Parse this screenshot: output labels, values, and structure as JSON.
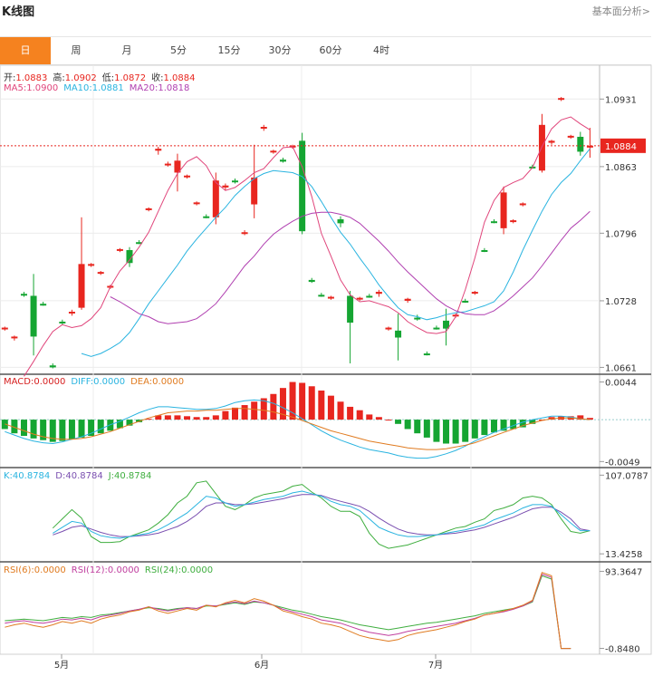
{
  "header": {
    "title": "K线图",
    "link": "基本面分析>"
  },
  "tabs": [
    "日",
    "周",
    "月",
    "5分",
    "15分",
    "30分",
    "60分",
    "4时"
  ],
  "active_tab": 0,
  "legends": {
    "ohlc": [
      {
        "label": "开:",
        "value": "1.0883"
      },
      {
        "label": "高:",
        "value": "1.0902"
      },
      {
        "label": "低:",
        "value": "1.0872"
      },
      {
        "label": "收:",
        "value": "1.0884"
      }
    ],
    "ma": [
      {
        "label": "MA5:",
        "value": "1.0900"
      },
      {
        "label": "MA10:",
        "value": "1.0881"
      },
      {
        "label": "MA20:",
        "value": "1.0818"
      }
    ],
    "macd": [
      {
        "label": "MACD:",
        "value": "0.0000"
      },
      {
        "label": "DIFF:",
        "value": "0.0000"
      },
      {
        "label": "DEA:",
        "value": "0.0000"
      }
    ],
    "kdj": [
      {
        "label": "K:",
        "value": "40.8784"
      },
      {
        "label": "D:",
        "value": "40.8784"
      },
      {
        "label": "J:",
        "value": "40.8784"
      }
    ],
    "rsi": [
      {
        "label": "RSI(6):",
        "value": "0.0000"
      },
      {
        "label": "RSI(12):",
        "value": "0.0000"
      },
      {
        "label": "RSI(24):",
        "value": "0.0000"
      }
    ]
  },
  "colors": {
    "up": "#e8261f",
    "down": "#15a532",
    "ma5": "#e0457b",
    "ma10": "#2ab4e0",
    "ma20": "#b03fb0",
    "diff": "#2ab4e0",
    "dea": "#e07b20",
    "k": "#2ab4e0",
    "d": "#7a4fb0",
    "j": "#3fae3f",
    "rsi6": "#e07b20",
    "rsi12": "#c03f9f",
    "rsi24": "#3fae3f"
  },
  "chart_data": {
    "type": "candlestick",
    "x_labels": [
      {
        "index": 5,
        "label": "5月"
      },
      {
        "index": 25,
        "label": "6月"
      },
      {
        "index": 43,
        "label": "7月"
      }
    ],
    "last_price_label": "1.0884",
    "price_ylim": [
      1.0655,
      1.0965
    ],
    "price_ticks": [
      "1.0931",
      "1.0863",
      "1.0796",
      "1.0728",
      "1.0661"
    ],
    "candles": [
      {
        "o": 1.07,
        "h": 1.0702,
        "l": 1.0698,
        "c": 1.0701
      },
      {
        "o": 1.0691,
        "h": 1.0693,
        "l": 1.0688,
        "c": 1.0692
      },
      {
        "o": 1.0735,
        "h": 1.0737,
        "l": 1.0732,
        "c": 1.0734
      },
      {
        "o": 1.0733,
        "h": 1.0755,
        "l": 1.0673,
        "c": 1.0692
      },
      {
        "o": 1.0725,
        "h": 1.0727,
        "l": 1.0723,
        "c": 1.0724
      },
      {
        "o": 1.0663,
        "h": 1.0665,
        "l": 1.066,
        "c": 1.0661
      },
      {
        "o": 1.0707,
        "h": 1.0709,
        "l": 1.0704,
        "c": 1.0706
      },
      {
        "o": 1.0716,
        "h": 1.0719,
        "l": 1.0713,
        "c": 1.0717
      },
      {
        "o": 1.0721,
        "h": 1.0812,
        "l": 1.0719,
        "c": 1.0765
      },
      {
        "o": 1.0764,
        "h": 1.0766,
        "l": 1.0762,
        "c": 1.0765
      },
      {
        "o": 1.0756,
        "h": 1.0758,
        "l": 1.0754,
        "c": 1.0757
      },
      {
        "o": 1.0742,
        "h": 1.0744,
        "l": 1.074,
        "c": 1.0743
      },
      {
        "o": 1.0779,
        "h": 1.0781,
        "l": 1.0777,
        "c": 1.078
      },
      {
        "o": 1.0779,
        "h": 1.0782,
        "l": 1.0762,
        "c": 1.0766
      },
      {
        "o": 1.0787,
        "h": 1.0789,
        "l": 1.0785,
        "c": 1.0786
      },
      {
        "o": 1.082,
        "h": 1.0822,
        "l": 1.0818,
        "c": 1.0821
      },
      {
        "o": 1.0879,
        "h": 1.0883,
        "l": 1.0875,
        "c": 1.0881
      },
      {
        "o": 1.0865,
        "h": 1.0868,
        "l": 1.0863,
        "c": 1.0866
      },
      {
        "o": 1.0857,
        "h": 1.0876,
        "l": 1.0838,
        "c": 1.0869
      },
      {
        "o": 1.0853,
        "h": 1.0855,
        "l": 1.0851,
        "c": 1.0854
      },
      {
        "o": 1.0826,
        "h": 1.0828,
        "l": 1.0824,
        "c": 1.0827
      },
      {
        "o": 1.0813,
        "h": 1.0815,
        "l": 1.0811,
        "c": 1.0812
      },
      {
        "o": 1.0812,
        "h": 1.0857,
        "l": 1.0805,
        "c": 1.0849
      },
      {
        "o": 1.0842,
        "h": 1.0846,
        "l": 1.0839,
        "c": 1.0844
      },
      {
        "o": 1.0849,
        "h": 1.0851,
        "l": 1.0846,
        "c": 1.0848
      },
      {
        "o": 1.0796,
        "h": 1.0799,
        "l": 1.0794,
        "c": 1.0797
      },
      {
        "o": 1.0825,
        "h": 1.0885,
        "l": 1.0811,
        "c": 1.0852
      },
      {
        "o": 1.0902,
        "h": 1.0905,
        "l": 1.0899,
        "c": 1.0903
      },
      {
        "o": 1.0878,
        "h": 1.088,
        "l": 1.0876,
        "c": 1.0879
      },
      {
        "o": 1.087,
        "h": 1.0872,
        "l": 1.0867,
        "c": 1.0868
      },
      {
        "o": 1.0883,
        "h": 1.0885,
        "l": 1.0881,
        "c": 1.0884
      },
      {
        "o": 1.0889,
        "h": 1.0897,
        "l": 1.0795,
        "c": 1.0798
      },
      {
        "o": 1.0749,
        "h": 1.0751,
        "l": 1.0746,
        "c": 1.0747
      },
      {
        "o": 1.0734,
        "h": 1.0736,
        "l": 1.0732,
        "c": 1.0733
      },
      {
        "o": 1.0731,
        "h": 1.0733,
        "l": 1.0729,
        "c": 1.0732
      },
      {
        "o": 1.081,
        "h": 1.0813,
        "l": 1.0802,
        "c": 1.0806
      },
      {
        "o": 1.0733,
        "h": 1.0738,
        "l": 1.0665,
        "c": 1.0706
      },
      {
        "o": 1.073,
        "h": 1.0732,
        "l": 1.0728,
        "c": 1.0731
      },
      {
        "o": 1.0733,
        "h": 1.0735,
        "l": 1.0731,
        "c": 1.0732
      },
      {
        "o": 1.0735,
        "h": 1.0739,
        "l": 1.0732,
        "c": 1.0737
      },
      {
        "o": 1.07,
        "h": 1.0702,
        "l": 1.0698,
        "c": 1.0701
      },
      {
        "o": 1.0698,
        "h": 1.0715,
        "l": 1.0668,
        "c": 1.0691
      },
      {
        "o": 1.0728,
        "h": 1.0731,
        "l": 1.0726,
        "c": 1.073
      },
      {
        "o": 1.0711,
        "h": 1.0714,
        "l": 1.0708,
        "c": 1.071
      },
      {
        "o": 1.0675,
        "h": 1.0677,
        "l": 1.0673,
        "c": 1.0674
      },
      {
        "o": 1.0701,
        "h": 1.0703,
        "l": 1.0699,
        "c": 1.07
      },
      {
        "o": 1.0708,
        "h": 1.072,
        "l": 1.0683,
        "c": 1.07
      },
      {
        "o": 1.0713,
        "h": 1.0715,
        "l": 1.0711,
        "c": 1.0714
      },
      {
        "o": 1.0728,
        "h": 1.073,
        "l": 1.0726,
        "c": 1.0727
      },
      {
        "o": 1.0736,
        "h": 1.0738,
        "l": 1.0734,
        "c": 1.0737
      },
      {
        "o": 1.0779,
        "h": 1.0781,
        "l": 1.0777,
        "c": 1.0778
      },
      {
        "o": 1.0808,
        "h": 1.081,
        "l": 1.0806,
        "c": 1.0807
      },
      {
        "o": 1.0801,
        "h": 1.0843,
        "l": 1.0795,
        "c": 1.0837
      },
      {
        "o": 1.0808,
        "h": 1.081,
        "l": 1.0806,
        "c": 1.0809
      },
      {
        "o": 1.0825,
        "h": 1.0827,
        "l": 1.0823,
        "c": 1.0826
      },
      {
        "o": 1.0863,
        "h": 1.0865,
        "l": 1.0861,
        "c": 1.0862
      },
      {
        "o": 1.0859,
        "h": 1.0916,
        "l": 1.0857,
        "c": 1.0905
      },
      {
        "o": 1.0887,
        "h": 1.089,
        "l": 1.0885,
        "c": 1.0889
      },
      {
        "o": 1.0931,
        "h": 1.0933,
        "l": 1.0929,
        "c": 1.0932
      },
      {
        "o": 1.0893,
        "h": 1.0895,
        "l": 1.0891,
        "c": 1.0894
      },
      {
        "o": 1.0893,
        "h": 1.0898,
        "l": 1.0874,
        "c": 1.0878
      },
      {
        "o": 1.0883,
        "h": 1.0902,
        "l": 1.0872,
        "c": 1.0884
      }
    ],
    "ma5": [
      1.0652,
      1.0667,
      1.0683,
      1.0697,
      1.0704,
      1.0701,
      1.0703,
      1.071,
      1.0721,
      1.0742,
      1.0758,
      1.0769,
      1.0782,
      1.0797,
      1.0818,
      1.0839,
      1.0856,
      1.0868,
      1.0873,
      1.0864,
      1.0847,
      1.0839,
      1.0842,
      1.0849,
      1.0857,
      1.0861,
      1.0872,
      1.0882,
      1.0883,
      1.0863,
      1.0833,
      1.0796,
      1.0773,
      1.0749,
      1.0734,
      1.0727,
      1.0728,
      1.0725,
      1.0722,
      1.0716,
      1.0707,
      1.0701,
      1.0696,
      1.0695,
      1.0697,
      1.0712,
      1.0739,
      1.0771,
      1.0807,
      1.0829,
      1.0842,
      1.0847,
      1.0851,
      1.0862,
      1.0883,
      1.0901,
      1.091,
      1.0913,
      1.0906,
      1.09
    ],
    "ma10": [
      1.0675,
      1.0672,
      1.0675,
      1.068,
      1.0686,
      1.0696,
      1.071,
      1.0725,
      1.0738,
      1.0751,
      1.0764,
      1.0778,
      1.079,
      1.0801,
      1.0812,
      1.0822,
      1.0834,
      1.0843,
      1.0851,
      1.0856,
      1.0859,
      1.0858,
      1.0857,
      1.0853,
      1.0843,
      1.0828,
      1.0812,
      1.0797,
      1.0785,
      1.0771,
      1.0758,
      1.0744,
      1.0732,
      1.0721,
      1.0714,
      1.0712,
      1.0709,
      1.0711,
      1.0714,
      1.0716,
      1.0717,
      1.072,
      1.0723,
      1.0727,
      1.0738,
      1.0757,
      1.0779,
      1.0799,
      1.0818,
      1.0835,
      1.0847,
      1.0856,
      1.0869,
      1.0881
    ],
    "ma20": [
      1.0732,
      1.0727,
      1.0721,
      1.0715,
      1.0712,
      1.0707,
      1.0705,
      1.0706,
      1.0707,
      1.071,
      1.0717,
      1.0725,
      1.0737,
      1.075,
      1.0763,
      1.0773,
      1.0785,
      1.0795,
      1.0802,
      1.0808,
      1.0813,
      1.0816,
      1.0817,
      1.0817,
      1.0815,
      1.0812,
      1.0806,
      1.0797,
      1.0788,
      1.0778,
      1.0767,
      1.0757,
      1.0748,
      1.0739,
      1.073,
      1.0723,
      1.0718,
      1.0715,
      1.0714,
      1.0714,
      1.0718,
      1.0725,
      1.0733,
      1.0742,
      1.0751,
      1.0763,
      1.0776,
      1.0789,
      1.0801,
      1.0809,
      1.0818
    ],
    "macd": {
      "ylim": [
        -0.0055,
        0.0052
      ],
      "ticks": [
        "0.0044",
        "-0.0049"
      ],
      "bars": [
        -0.0011,
        -0.0016,
        -0.0019,
        -0.0022,
        -0.0024,
        -0.0026,
        -0.0025,
        -0.0023,
        -0.0021,
        -0.0019,
        -0.0016,
        -0.0013,
        -0.001,
        -0.0007,
        -0.0003,
        0.0001,
        0.0005,
        0.0005,
        0.0005,
        0.0004,
        0.0003,
        0.0003,
        0.0005,
        0.001,
        0.0014,
        0.0017,
        0.0021,
        0.0025,
        0.003,
        0.0037,
        0.0044,
        0.0043,
        0.0039,
        0.0034,
        0.0028,
        0.0021,
        0.0015,
        0.0011,
        0.0006,
        0.0003,
        0.0,
        -0.0005,
        -0.0011,
        -0.0016,
        -0.0021,
        -0.0026,
        -0.0028,
        -0.0028,
        -0.0026,
        -0.0022,
        -0.0018,
        -0.0015,
        -0.0013,
        -0.0011,
        -0.0009,
        -0.0005,
        0.0,
        0.0003,
        0.0004,
        0.0004,
        0.0005,
        0.0002
      ],
      "diff": [
        -0.0014,
        -0.0018,
        -0.0022,
        -0.0025,
        -0.0027,
        -0.0028,
        -0.0026,
        -0.0023,
        -0.002,
        -0.0016,
        -0.0011,
        -0.0006,
        -0.0002,
        0.0003,
        0.0008,
        0.0012,
        0.0015,
        0.0015,
        0.0014,
        0.0013,
        0.0012,
        0.0012,
        0.0013,
        0.0016,
        0.002,
        0.0022,
        0.0023,
        0.0022,
        0.0019,
        0.0014,
        0.0008,
        0.0001,
        -0.0006,
        -0.0013,
        -0.0019,
        -0.0024,
        -0.0028,
        -0.0032,
        -0.0035,
        -0.0037,
        -0.0039,
        -0.0042,
        -0.0044,
        -0.0045,
        -0.0045,
        -0.0043,
        -0.004,
        -0.0036,
        -0.0031,
        -0.0025,
        -0.002,
        -0.0015,
        -0.0011,
        -0.0007,
        -0.0003,
        0.0,
        0.0002,
        0.0004,
        0.0004,
        0.0003,
        0.0001,
        0.0
      ],
      "dea": [
        -0.0005,
        -0.0009,
        -0.0013,
        -0.0017,
        -0.002,
        -0.0022,
        -0.0023,
        -0.0023,
        -0.0022,
        -0.002,
        -0.0017,
        -0.0014,
        -0.001,
        -0.0006,
        -0.0002,
        0.0002,
        0.0005,
        0.0008,
        0.0009,
        0.001,
        0.001,
        0.0011,
        0.0011,
        0.0012,
        0.0013,
        0.0013,
        0.0012,
        0.0011,
        0.0009,
        0.0006,
        0.0003,
        -0.0001,
        -0.0005,
        -0.0009,
        -0.0013,
        -0.0016,
        -0.0019,
        -0.0022,
        -0.0025,
        -0.0027,
        -0.0029,
        -0.0031,
        -0.0033,
        -0.0034,
        -0.0035,
        -0.0035,
        -0.0034,
        -0.0032,
        -0.003,
        -0.0027,
        -0.0023,
        -0.0019,
        -0.0015,
        -0.0011,
        -0.0007,
        -0.0004,
        -0.0001,
        0.0001,
        0.0002,
        0.0002,
        0.0001,
        0.0
      ]
    },
    "kdj": {
      "ylim": [
        5,
        115
      ],
      "ticks": [
        "107.0787",
        "13.4258"
      ],
      "k": [
        38,
        45,
        52,
        50,
        40,
        35,
        33,
        32,
        34,
        36,
        38,
        42,
        48,
        55,
        62,
        72,
        82,
        80,
        74,
        70,
        72,
        75,
        78,
        80,
        82,
        86,
        88,
        85,
        82,
        76,
        72,
        70,
        65,
        55,
        45,
        40,
        36,
        34,
        34,
        35,
        36,
        38,
        40,
        42,
        45,
        48,
        54,
        58,
        62,
        68,
        72,
        72,
        70,
        60,
        50,
        41,
        41
      ],
      "d": [
        36,
        40,
        45,
        47,
        43,
        39,
        36,
        34,
        34,
        35,
        36,
        38,
        42,
        46,
        52,
        60,
        70,
        74,
        74,
        72,
        72,
        73,
        75,
        77,
        79,
        82,
        84,
        84,
        83,
        79,
        76,
        73,
        70,
        64,
        56,
        49,
        43,
        39,
        37,
        36,
        36,
        37,
        38,
        40,
        42,
        45,
        49,
        53,
        57,
        62,
        67,
        69,
        69,
        63,
        55,
        43,
        41
      ],
      "j": [
        44,
        55,
        66,
        56,
        34,
        27,
        27,
        28,
        34,
        38,
        42,
        50,
        60,
        74,
        82,
        98,
        100,
        85,
        70,
        66,
        72,
        80,
        84,
        86,
        88,
        94,
        96,
        87,
        80,
        70,
        64,
        64,
        58,
        38,
        25,
        20,
        22,
        24,
        28,
        32,
        36,
        40,
        44,
        46,
        51,
        55,
        65,
        68,
        72,
        80,
        82,
        80,
        72,
        55,
        40,
        38,
        41
      ]
    },
    "rsi": {
      "ylim": [
        -8,
        104
      ],
      "ticks": [
        "93.3647",
        "-0.8480"
      ],
      "rsi6": [
        25,
        28,
        30,
        27,
        25,
        28,
        32,
        30,
        33,
        30,
        35,
        38,
        40,
        44,
        46,
        50,
        45,
        42,
        45,
        48,
        46,
        52,
        50,
        55,
        58,
        55,
        60,
        57,
        52,
        45,
        42,
        38,
        35,
        30,
        28,
        25,
        20,
        15,
        12,
        10,
        8,
        10,
        15,
        18,
        20,
        22,
        25,
        28,
        32,
        35,
        40,
        42,
        45,
        48,
        52,
        58,
        92,
        88,
        -0.85,
        -0.85
      ],
      "rsi12": [
        30,
        32,
        33,
        31,
        30,
        32,
        35,
        34,
        36,
        34,
        38,
        40,
        42,
        45,
        47,
        50,
        47,
        45,
        47,
        49,
        48,
        52,
        51,
        54,
        56,
        54,
        57,
        55,
        52,
        47,
        44,
        41,
        38,
        34,
        32,
        30,
        26,
        22,
        19,
        17,
        15,
        17,
        20,
        22,
        24,
        26,
        28,
        30,
        33,
        36,
        40,
        42,
        44,
        47,
        51,
        57,
        90,
        86,
        -0.85,
        -0.85
      ],
      "rsi24": [
        33,
        34,
        35,
        34,
        33,
        35,
        37,
        36,
        38,
        37,
        40,
        41,
        43,
        45,
        47,
        49,
        48,
        46,
        48,
        49,
        48,
        51,
        51,
        53,
        55,
        53,
        56,
        55,
        52,
        49,
        46,
        44,
        41,
        38,
        36,
        34,
        31,
        28,
        26,
        24,
        22,
        24,
        26,
        28,
        30,
        31,
        33,
        35,
        37,
        39,
        42,
        44,
        46,
        48,
        51,
        56,
        88,
        84,
        -0.85,
        -0.85
      ]
    }
  }
}
